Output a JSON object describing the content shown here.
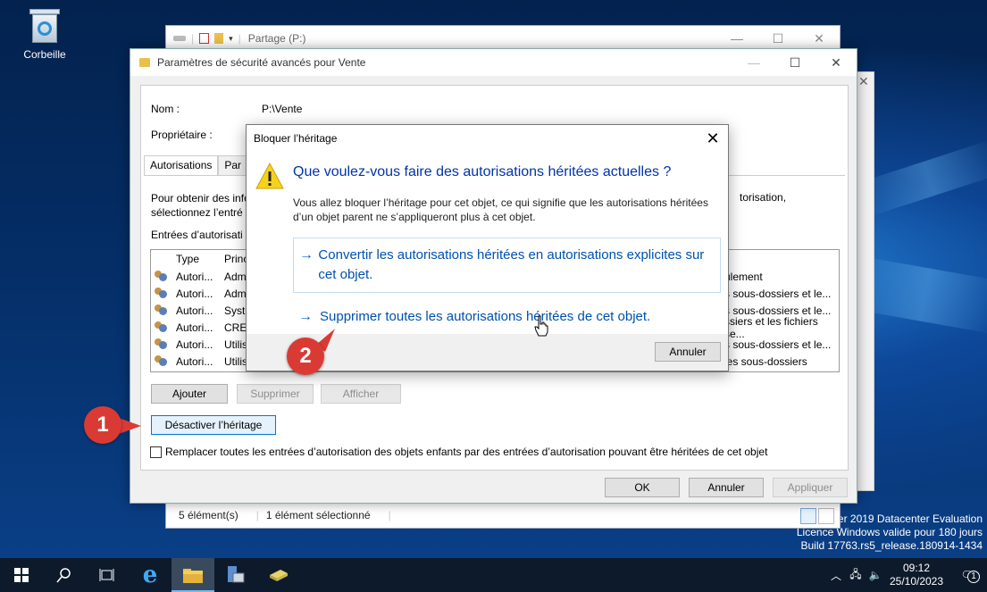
{
  "desktop": {
    "recycle_label": "Corbeille",
    "watermark": [
      "ver 2019 Datacenter Evaluation",
      "Licence Windows valide pour 180 jours",
      "Build 17763.rs5_release.180914-1434"
    ]
  },
  "explorer": {
    "title": "Partage (P:)",
    "status_count": "5 élément(s)",
    "status_selected": "1 élément sélectionné"
  },
  "security_window": {
    "title": "Paramètres de sécurité avancés pour Vente",
    "name_label": "Nom :",
    "name_value": "P:\\Vente",
    "owner_label": "Propriétaire :",
    "tabs": [
      "Autorisations",
      "Par"
    ],
    "description_line1": "Pour obtenir des info",
    "description_line2": "sélectionnez l’entré",
    "description_right": "torisation,",
    "entries_label": "Entrées d’autorisati",
    "columns": [
      "Type",
      "Princ"
    ],
    "rows": [
      {
        "type": "Autori...",
        "principal": "Adm",
        "applies": "ulement"
      },
      {
        "type": "Autori...",
        "principal": "Adm",
        "applies": "s sous-dossiers et le..."
      },
      {
        "type": "Autori...",
        "principal": "Systè",
        "applies": "s sous-dossiers et le..."
      },
      {
        "type": "Autori...",
        "principal": "CREA",
        "applies": "ssiers et les fichiers se..."
      },
      {
        "type": "Autori...",
        "principal": "Utilis",
        "applies": "s sous-dossiers et le..."
      },
      {
        "type": "Autori...",
        "principal": "Utilis",
        "applies": "les sous-dossiers"
      }
    ],
    "add_button": "Ajouter",
    "remove_button": "Supprimer",
    "view_button": "Afficher",
    "disable_inheritance_button": "Désactiver l’héritage",
    "replace_checkbox_label": "Remplacer toutes les entrées d’autorisation des objets enfants par des entrées d’autorisation pouvant être héritées de cet objet",
    "ok_button": "OK",
    "cancel_button": "Annuler",
    "apply_button": "Appliquer"
  },
  "dialog": {
    "title": "Bloquer l’héritage",
    "heading": "Que voulez-vous faire des autorisations héritées actuelles ?",
    "body": "Vous allez bloquer l’héritage pour cet objet, ce qui signifie que les autorisations héritées d’un objet parent ne s’appliqueront plus à cet objet.",
    "option_convert": "Convertir les autorisations héritées en autorisations explicites sur cet objet.",
    "option_remove": "Supprimer toutes les autorisations héritées de cet objet.",
    "cancel_button": "Annuler"
  },
  "badges": {
    "one": "1",
    "two": "2"
  },
  "colors": {
    "badge": "#d93b34",
    "link": "#0050b0",
    "heading": "#0033aa",
    "taskbar": "#0d1a2b"
  },
  "taskbar": {
    "time": "09:12",
    "date": "25/10/2023",
    "notification_count": "1"
  }
}
